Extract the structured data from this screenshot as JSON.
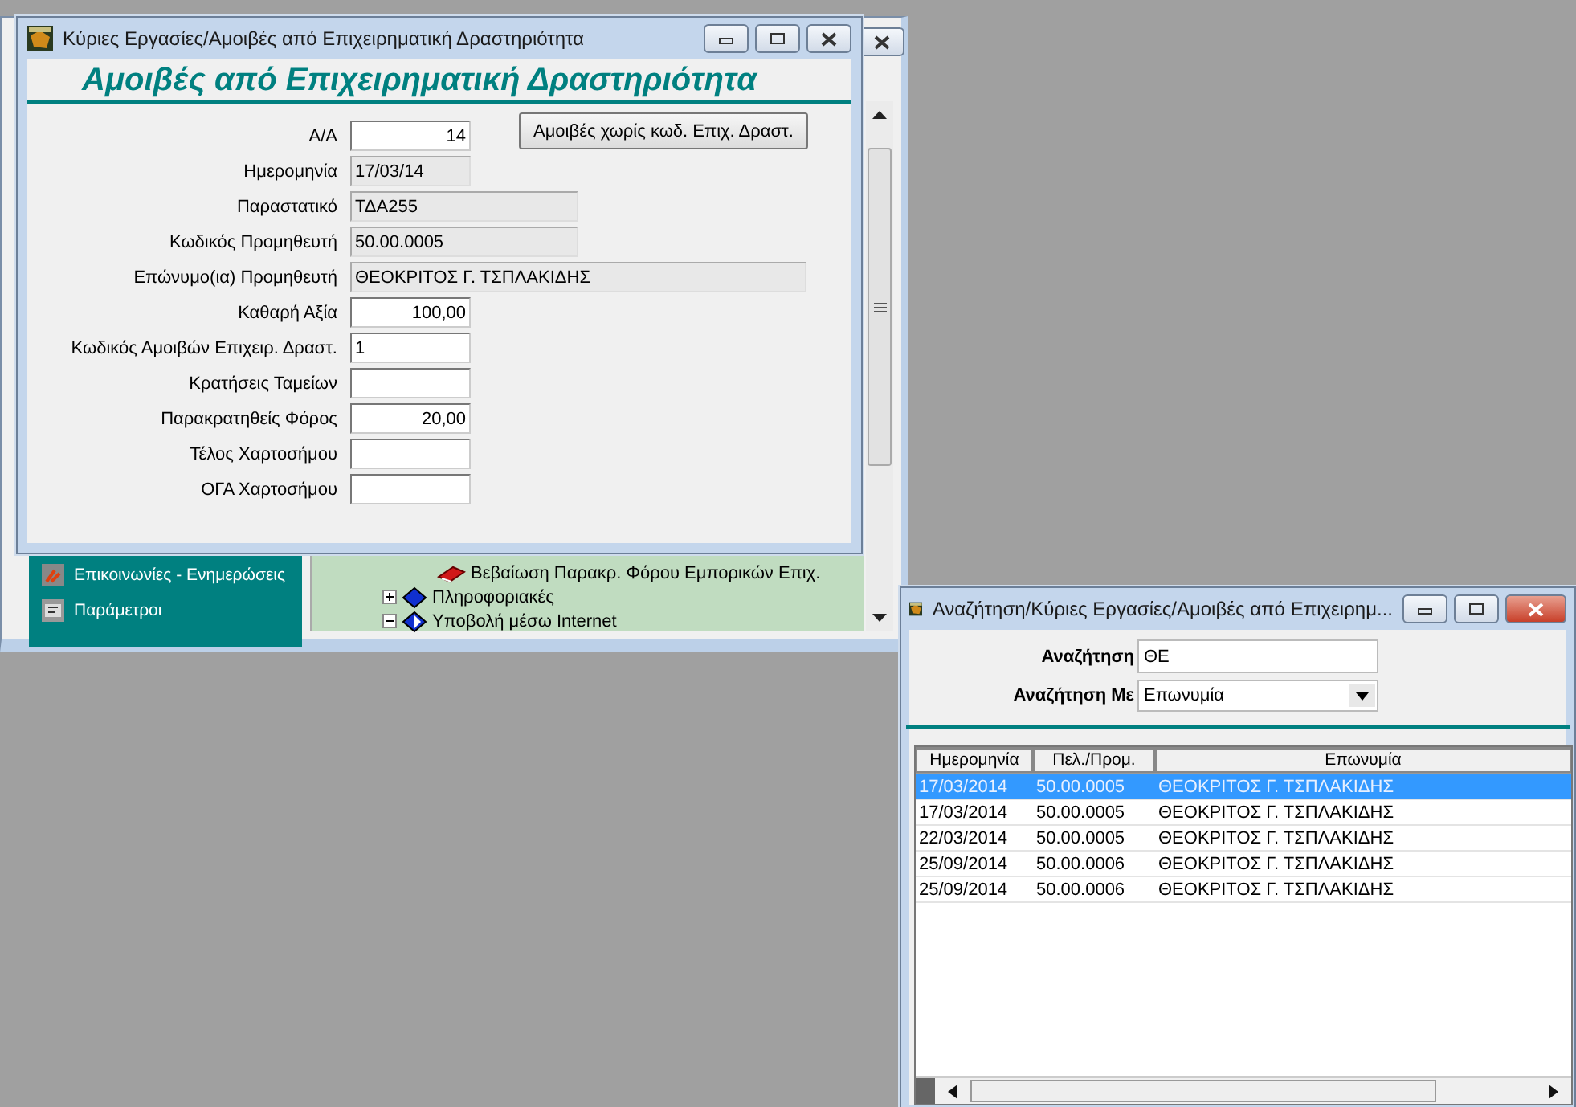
{
  "background_window": {
    "sidebar_items": [
      {
        "label": "Επικοινωνίες - Ενημερώσεις",
        "kind": "comms"
      },
      {
        "label": "Παράμετροι",
        "kind": "settings"
      }
    ],
    "tree_items": [
      {
        "label": "Βεβαίωση Παρακρ. Φόρου Εμπορικών Επιχ.",
        "kind": "document"
      },
      {
        "label": "Πληροφοριακές",
        "kind": "folder",
        "expanded": false
      },
      {
        "label": "Υποβολή μέσω Internet",
        "kind": "folder",
        "expanded": true
      }
    ]
  },
  "form_window": {
    "title": "Κύριες Εργασίες/Αμοιβές από Επιχειρηματική Δραστηριότητα",
    "heading": "Αμοιβές από Επιχειρηματική Δραστηριότητα",
    "button": "Αμοιβές χωρίς κωδ. Επιχ. Δραστ.",
    "fields": [
      {
        "label": "Α/Α",
        "value": "14",
        "kind": "number"
      },
      {
        "label": "Ημερομηνία",
        "value": "17/03/14",
        "kind": "date"
      },
      {
        "label": "Παραστατικό",
        "value": "ΤΔΑ255",
        "kind": "code"
      },
      {
        "label": "Κωδικός Προμηθευτή",
        "value": "50.00.0005",
        "kind": "code"
      },
      {
        "label": "Επώνυμο(ια) Προμηθευτή",
        "value": "ΘΕΟΚΡΙΤΟΣ Γ. ΤΣΠΛΑΚΙΔΗΣ",
        "kind": "name"
      },
      {
        "label": "Καθαρή Αξία",
        "value": "100,00",
        "kind": "number"
      },
      {
        "label": "Κωδικός Αμοιβών Επιχειρ. Δραστ.",
        "value": "1",
        "kind": "text"
      },
      {
        "label": "Κρατήσεις Ταμείων",
        "kind": "number"
      },
      {
        "label": "Παρακρατηθείς Φόρος",
        "value": "20,00",
        "kind": "number"
      },
      {
        "label": "Τέλος Χαρτοσήμου",
        "kind": "number"
      },
      {
        "label": "ΟΓΑ Χαρτοσήμου",
        "kind": "number"
      }
    ]
  },
  "search_window": {
    "title": "Αναζήτηση/Κύριες Εργασίες/Αμοιβές από Επιχειρημ...",
    "search": {
      "label": "Αναζήτηση",
      "value": "ΘΕ"
    },
    "search_by": {
      "label": "Αναζήτηση Με",
      "value": "Επωνυμία"
    },
    "table": {
      "columns": [
        "Ημερομηνία",
        "Πελ./Προμ.",
        "Επωνυμία"
      ],
      "rows": [
        {
          "cells": [
            "17/03/2014",
            "50.00.0005",
            "ΘΕΟΚΡΙΤΟΣ Γ. ΤΣΠΛΑΚΙΔΗΣ"
          ],
          "selected": true
        },
        {
          "cells": [
            "17/03/2014",
            "50.00.0005",
            "ΘΕΟΚΡΙΤΟΣ Γ. ΤΣΠΛΑΚΙΔΗΣ"
          ],
          "selected": false
        },
        {
          "cells": [
            "22/03/2014",
            "50.00.0005",
            "ΘΕΟΚΡΙΤΟΣ Γ. ΤΣΠΛΑΚΙΔΗΣ"
          ],
          "selected": false
        },
        {
          "cells": [
            "25/09/2014",
            "50.00.0006",
            "ΘΕΟΚΡΙΤΟΣ Γ. ΤΣΠΛΑΚΙΔΗΣ"
          ],
          "selected": false
        },
        {
          "cells": [
            "25/09/2014",
            "50.00.0006",
            "ΘΕΟΚΡΙΤΟΣ Γ. ΤΣΠΛΑΚΙΔΗΣ"
          ],
          "selected": false
        }
      ]
    }
  }
}
